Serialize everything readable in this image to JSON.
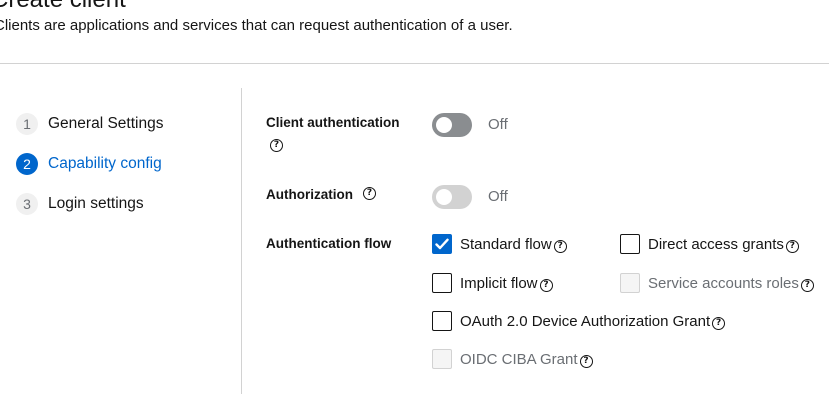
{
  "header": {
    "title": "Create client",
    "description": "Clients are applications and services that can request authentication of a user."
  },
  "wizard": {
    "steps": [
      {
        "number": "1",
        "label": "General Settings",
        "active": false
      },
      {
        "number": "2",
        "label": "Capability config",
        "active": true
      },
      {
        "number": "3",
        "label": "Login settings",
        "active": false
      }
    ]
  },
  "form": {
    "client_authentication": {
      "label": "Client authentication",
      "state": "Off",
      "help_icon": "question-circle-icon"
    },
    "authorization": {
      "label": "Authorization",
      "state": "Off",
      "disabled": true,
      "help_icon": "question-circle-icon"
    },
    "authentication_flow": {
      "label": "Authentication flow",
      "options": [
        {
          "label": "Standard flow",
          "checked": true,
          "disabled": false
        },
        {
          "label": "Direct access grants",
          "checked": false,
          "disabled": false
        },
        {
          "label": "Implicit flow",
          "checked": false,
          "disabled": false
        },
        {
          "label": "Service accounts roles",
          "checked": false,
          "disabled": true
        },
        {
          "label": "OAuth 2.0 Device Authorization Grant",
          "checked": false,
          "disabled": false
        },
        {
          "label": "OIDC CIBA Grant",
          "checked": false,
          "disabled": true
        }
      ]
    }
  },
  "colors": {
    "accent": "#0066cc",
    "switch_off": "#8a8d90",
    "switch_disabled": "#d2d2d2",
    "divider": "#d2d2d2"
  }
}
